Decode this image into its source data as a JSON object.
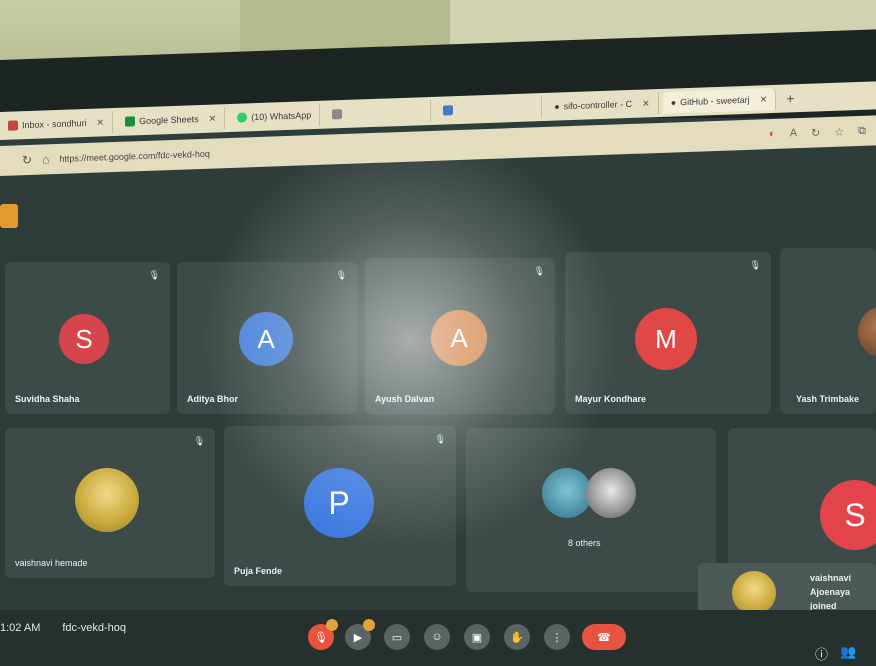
{
  "browser": {
    "tabs": [
      {
        "label": "Inbox - sondhuri",
        "icon_color": "#c5443b"
      },
      {
        "label": "Google Sheets",
        "icon_color": "#1e8e3e"
      },
      {
        "label": "(10) WhatsApp",
        "icon_color": "#25d366"
      },
      {
        "label": "",
        "icon_color": "#8a8a8a"
      },
      {
        "label": "",
        "icon_color": "#4a78c2"
      },
      {
        "label": "sifo-controller - C",
        "icon_color": "#333333"
      },
      {
        "label": "GitHub - sweetarj",
        "icon_color": "#111111"
      }
    ],
    "tab_close_glyph": "✕",
    "new_tab_glyph": "+",
    "address": "https://meet.google.com/fdc-vekd-hoq",
    "toolbar_icons": [
      "tracking-icon",
      "reader-icon",
      "refresh-icon",
      "favorite-icon",
      "collections-icon"
    ]
  },
  "meeting": {
    "time": "1:02 AM",
    "code": "fdc-vekd-hoq"
  },
  "participants_row1": [
    {
      "name": "Suvidha Shaha",
      "initial": "S",
      "color": "#d6454b"
    },
    {
      "name": "Aditya Bhor",
      "initial": "A",
      "color": "#4a82d8"
    },
    {
      "name": "Ayush Dalvan",
      "initial": "A",
      "color": "#d07a3a"
    },
    {
      "name": "Mayur Kondhare",
      "initial": "M",
      "color": "#e04846"
    },
    {
      "name": "Yash Trimbake",
      "initial": "",
      "color": "#8a5a3a"
    }
  ],
  "participants_row2": [
    {
      "name": "vaishnavi hemade",
      "initial": "",
      "color": "#d9c85a"
    },
    {
      "name": "Puja Fende",
      "initial": "P",
      "color": "#3f7be0"
    },
    {
      "name": "8 others",
      "initial": "",
      "color": "#6aa0b8"
    },
    {
      "name": "",
      "initial": "S",
      "color": "#e3434b"
    }
  ],
  "toast": {
    "line1": "vaishnavi",
    "line2": "Ajoenaya",
    "line3": "joined"
  },
  "controls": [
    "mic-icon",
    "camera-icon",
    "captions-icon",
    "emoji-icon",
    "present-icon",
    "raise-hand-icon",
    "more-icon",
    "end-call-icon"
  ],
  "colors": {
    "end_call": "#e8533f",
    "mic_badge": "#e8a13a",
    "tile_bg": "#3d4b48"
  }
}
